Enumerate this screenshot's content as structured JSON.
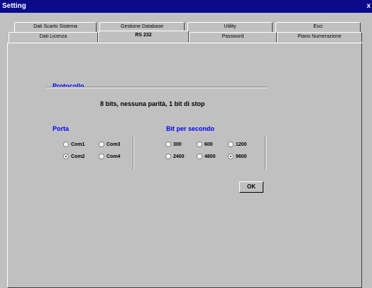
{
  "window": {
    "title": "Setting",
    "close_glyph": "x"
  },
  "tabs_row_back": [
    {
      "label": "Dati Scarto Sistema"
    },
    {
      "label": "Gestione Database"
    },
    {
      "label": "Utility"
    },
    {
      "label": "Esci"
    }
  ],
  "tabs_row_front": [
    {
      "label": "Dati Licenza"
    },
    {
      "label": "RS 232",
      "active": true
    },
    {
      "label": "Password"
    },
    {
      "label": "Piano Numerazione"
    }
  ],
  "protocol": {
    "legend": "Protocollo",
    "summary": "8 bits, nessuna parità, 1 bit di stop"
  },
  "port": {
    "legend": "Porta",
    "options": [
      "Com1",
      "Com3",
      "Com2",
      "Com4"
    ],
    "selected": "Com2"
  },
  "baud": {
    "legend": "Bit per secondo",
    "options": [
      "300",
      "600",
      "1200",
      "2400",
      "4800",
      "9600"
    ],
    "selected": "9600"
  },
  "ok_button": {
    "label": "OK"
  },
  "colors": {
    "titlebar": "#0a0a8a",
    "legend": "#0000ff",
    "face": "#c0c0c0"
  }
}
